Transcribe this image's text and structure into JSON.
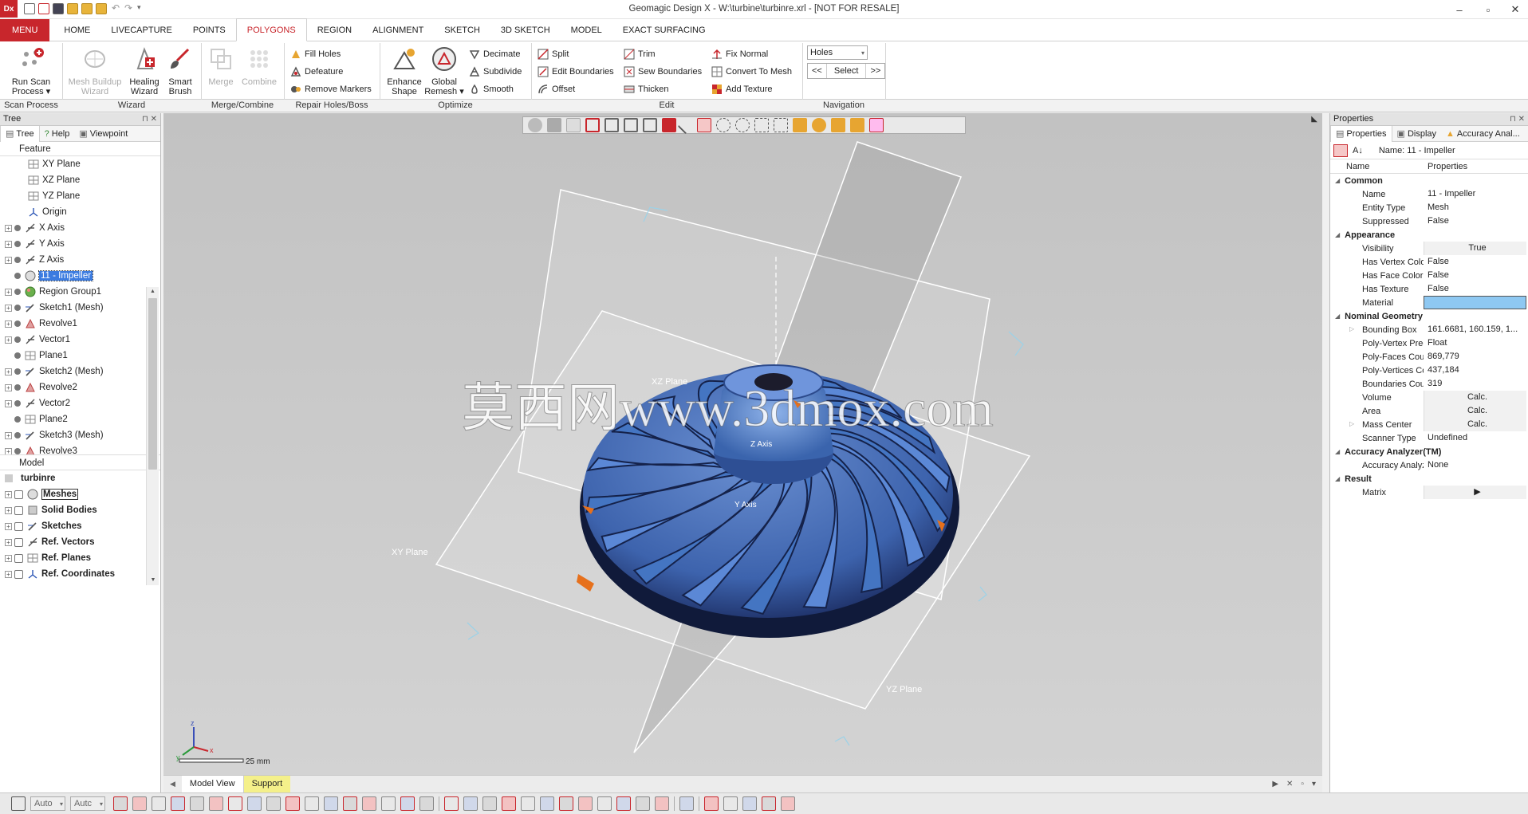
{
  "app": {
    "logo_text": "Dx",
    "title": "Geomagic Design X - W:\\turbine\\turbinre.xrl - [NOT FOR RESALE]",
    "window_controls": [
      "–",
      "▫",
      "✕"
    ]
  },
  "menu_tabs": [
    {
      "label": "MENU"
    },
    {
      "label": "HOME"
    },
    {
      "label": "LIVECAPTURE"
    },
    {
      "label": "POINTS"
    },
    {
      "label": "POLYGONS"
    },
    {
      "label": "REGION"
    },
    {
      "label": "ALIGNMENT"
    },
    {
      "label": "SKETCH"
    },
    {
      "label": "3D SKETCH"
    },
    {
      "label": "MODEL"
    },
    {
      "label": "EXACT SURFACING"
    }
  ],
  "ribbon": {
    "scan_process": {
      "label": "Scan Process",
      "run_scan": "Run Scan Process ▾"
    },
    "wizard": {
      "label": "Wizard",
      "mesh_buildup": "Mesh Buildup Wizard",
      "healing": "Healing Wizard",
      "smart_brush": "Smart Brush"
    },
    "merge": {
      "label": "Merge/Combine",
      "merge": "Merge",
      "combine": "Combine"
    },
    "repair": {
      "label": "Repair Holes/Boss",
      "fill_holes": "Fill Holes",
      "defeature": "Defeature",
      "remove_markers": "Remove Markers"
    },
    "optimize": {
      "label": "Optimize",
      "enhance_shape": "Enhance Shape",
      "global_remesh": "Global Remesh ▾",
      "decimate": "Decimate",
      "subdivide": "Subdivide",
      "smooth": "Smooth"
    },
    "edit": {
      "label": "Edit",
      "split": "Split",
      "edit_boundaries": "Edit Boundaries",
      "offset": "Offset",
      "trim": "Trim",
      "sew_boundaries": "Sew Boundaries",
      "thicken": "Thicken",
      "fix_normal": "Fix Normal",
      "convert_to_mesh": "Convert To Mesh",
      "add_texture": "Add Texture"
    },
    "navigation": {
      "label": "Navigation",
      "dropdown_value": "Holes",
      "prev": "<<",
      "select": "Select",
      "next": ">>"
    }
  },
  "tree_panel": {
    "title": "Tree",
    "tabs": [
      "Tree",
      "Help",
      "Viewpoint"
    ],
    "feature_header": "Feature",
    "features": [
      {
        "label": "XY Plane",
        "icon": "plane-icon",
        "expand": false
      },
      {
        "label": "XZ Plane",
        "icon": "plane-icon",
        "expand": false
      },
      {
        "label": "YZ Plane",
        "icon": "plane-icon",
        "expand": false
      },
      {
        "label": "Origin",
        "icon": "origin-icon",
        "expand": false
      },
      {
        "label": "X Axis",
        "icon": "axis-icon",
        "expand": true
      },
      {
        "label": "Y Axis",
        "icon": "axis-icon",
        "expand": true
      },
      {
        "label": "Z Axis",
        "icon": "axis-icon",
        "expand": true
      },
      {
        "label": "11 - Impeller",
        "icon": "mesh-icon",
        "expand": false,
        "selected": true
      },
      {
        "label": "Region Group1",
        "icon": "region-icon",
        "expand": true
      },
      {
        "label": "Sketch1 (Mesh)",
        "icon": "sketch-icon",
        "expand": true
      },
      {
        "label": "Revolve1",
        "icon": "revolve-icon",
        "expand": true
      },
      {
        "label": "Vector1",
        "icon": "axis-icon",
        "expand": true
      },
      {
        "label": "Plane1",
        "icon": "plane-icon",
        "expand": false
      },
      {
        "label": "Sketch2 (Mesh)",
        "icon": "sketch-icon",
        "expand": true
      },
      {
        "label": "Revolve2",
        "icon": "revolve-icon",
        "expand": true
      },
      {
        "label": "Vector2",
        "icon": "axis-icon",
        "expand": true
      },
      {
        "label": "Plane2",
        "icon": "plane-icon",
        "expand": false
      },
      {
        "label": "Sketch3 (Mesh)",
        "icon": "sketch-icon",
        "expand": true
      },
      {
        "label": "Revolve3",
        "icon": "revolve-icon",
        "expand": true
      }
    ],
    "model_header": "Model",
    "model_root": "turbinre",
    "model_items": [
      {
        "label": "Meshes",
        "icon": "mesh-icon"
      },
      {
        "label": "Solid Bodies",
        "icon": "solid-icon"
      },
      {
        "label": "Sketches",
        "icon": "sketch-icon"
      },
      {
        "label": "Ref. Vectors",
        "icon": "axis-icon"
      },
      {
        "label": "Ref. Planes",
        "icon": "plane-icon"
      },
      {
        "label": "Ref. Coordinates",
        "icon": "origin-icon"
      }
    ]
  },
  "properties_panel": {
    "title": "Properties",
    "tabs": [
      "Properties",
      "Display",
      "Accuracy Anal..."
    ],
    "name_line": "Name: 11 - Impeller",
    "col_name": "Name",
    "col_props": "Properties",
    "rows": [
      {
        "cat": "Common"
      },
      {
        "name": "Name",
        "value": "11 - Impeller"
      },
      {
        "name": "Entity Type",
        "value": "Mesh"
      },
      {
        "name": "Suppressed",
        "value": "False"
      },
      {
        "cat": "Appearance"
      },
      {
        "name": "Visibility",
        "value": "True",
        "center": true
      },
      {
        "name": "Has Vertex Color",
        "value": "False"
      },
      {
        "name": "Has Face Color",
        "value": "False"
      },
      {
        "name": "Has Texture",
        "value": "False"
      },
      {
        "name": "Material",
        "value": "",
        "swatch": "#8ec8f2"
      },
      {
        "cat": "Nominal Geometry"
      },
      {
        "name": "Bounding Box",
        "value": "161.6681, 160.159, 1...",
        "sub": true
      },
      {
        "name": "Poly-Vertex Preci...",
        "value": "Float"
      },
      {
        "name": "Poly-Faces Count",
        "value": "869,779"
      },
      {
        "name": "Poly-Vertices Co...",
        "value": "437,184"
      },
      {
        "name": "Boundaries Count",
        "value": "319"
      },
      {
        "name": "Volume",
        "value": "Calc.",
        "center": true
      },
      {
        "name": "Area",
        "value": "Calc.",
        "center": true
      },
      {
        "name": "Mass Center",
        "value": "Calc.",
        "center": true,
        "sub": true
      },
      {
        "name": "Scanner Type",
        "value": "Undefined"
      },
      {
        "cat": "Accuracy Analyzer(TM)"
      },
      {
        "name": "Accuracy Analyz...",
        "value": "None"
      },
      {
        "cat": "Result"
      },
      {
        "name": "Matrix",
        "value": "▶",
        "center": true
      }
    ]
  },
  "viewport": {
    "plane_labels": {
      "xz": "XZ Plane",
      "xy": "XY Plane",
      "yz": "YZ Plane"
    },
    "axis_labels": {
      "z": "Z Axis",
      "y": "Y Axis"
    },
    "watermark": "莫西网www.3dmox.com",
    "scale_label": "25 mm",
    "triad": {
      "x": "x",
      "y": "y",
      "z": "z"
    }
  },
  "view_tabs": [
    "Model View",
    "Support"
  ],
  "status_bar": {
    "combo1": "Auto",
    "combo2": "Autc"
  },
  "colors": {
    "brand_red": "#c8262c",
    "mesh_blue": "#4c7cc8",
    "mesh_dark": "#132047",
    "plane_white": "#ffffff"
  }
}
